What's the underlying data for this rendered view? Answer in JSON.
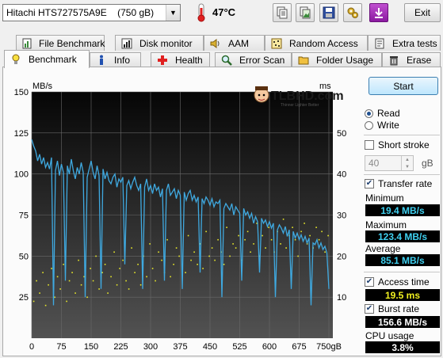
{
  "drive": {
    "name": "Hitachi HTS727575A9E",
    "size": "(750 gB)"
  },
  "temperature": "47°C",
  "exit_label": "Exit",
  "toolbar_icons": [
    "copy-text-icon",
    "copy-image-icon",
    "save-icon",
    "options-icon",
    "download-icon"
  ],
  "tabs_top": [
    {
      "label": "File Benchmark",
      "icon": "file-benchmark-icon"
    },
    {
      "label": "Disk monitor",
      "icon": "disk-monitor-icon"
    },
    {
      "label": "AAM",
      "icon": "speaker-icon"
    },
    {
      "label": "Random Access",
      "icon": "random-access-icon"
    },
    {
      "label": "Extra tests",
      "icon": "extra-tests-icon"
    }
  ],
  "tabs_bottom": [
    {
      "label": "Benchmark",
      "icon": "lightbulb-icon"
    },
    {
      "label": "Info",
      "icon": "info-icon"
    },
    {
      "label": "Health",
      "icon": "health-cross-icon"
    },
    {
      "label": "Error Scan",
      "icon": "magnifier-icon"
    },
    {
      "label": "Folder Usage",
      "icon": "folder-icon"
    },
    {
      "label": "Erase",
      "icon": "trash-icon"
    }
  ],
  "watermark": "TLBHD.com",
  "watermark_tagline": "Thinner Lighter Better",
  "controls": {
    "start_label": "Start",
    "read_label": "Read",
    "write_label": "Write",
    "read_selected": true,
    "short_stroke_label": "Short stroke",
    "short_stroke_checked": false,
    "short_stroke_value": "40",
    "short_stroke_unit": "gB",
    "transfer_rate_label": "Transfer rate",
    "transfer_rate_checked": true,
    "minimum_label": "Minimum",
    "minimum_value": "19.4 MB/s",
    "maximum_label": "Maximum",
    "maximum_value": "123.4 MB/s",
    "average_label": "Average",
    "average_value": "85.1 MB/s",
    "access_time_label": "Access time",
    "access_time_checked": true,
    "access_time_value": "19.5 ms",
    "burst_rate_label": "Burst rate",
    "burst_rate_checked": true,
    "burst_rate_value": "156.6 MB/s",
    "cpu_usage_label": "CPU usage",
    "cpu_usage_value": "3.8%"
  },
  "colors": {
    "transfer": "#3fa9e0",
    "access": "#e8e82a",
    "value_cyan": "#3fd0f0",
    "value_yellow": "#f0f020",
    "value_white": "#ffffff"
  },
  "chart_data": {
    "type": "line",
    "y_label": "MB/s",
    "y2_label": "ms",
    "x_unit": "gB",
    "x_ticks": [
      0,
      75,
      150,
      225,
      300,
      375,
      450,
      525,
      600,
      675,
      750
    ],
    "x_range": [
      0,
      760
    ],
    "y_ticks": [
      25,
      50,
      75,
      100,
      125,
      150
    ],
    "y_range": [
      0,
      150
    ],
    "y2_ticks": [
      10,
      20,
      30,
      40,
      50
    ],
    "y2_range": [
      0,
      60
    ],
    "grid": true,
    "series": [
      {
        "name": "Transfer rate",
        "unit": "MB/s",
        "x": [
          0,
          5,
          10,
          15,
          20,
          25,
          30,
          35,
          40,
          45,
          50,
          55,
          60,
          65,
          70,
          75,
          80,
          85,
          90,
          95,
          100,
          105,
          110,
          115,
          120,
          125,
          130,
          135,
          140,
          145,
          150,
          155,
          160,
          165,
          170,
          175,
          180,
          185,
          190,
          195,
          200,
          205,
          210,
          215,
          220,
          225,
          230,
          235,
          240,
          245,
          250,
          255,
          260,
          265,
          270,
          275,
          280,
          285,
          290,
          295,
          300,
          305,
          310,
          315,
          320,
          325,
          330,
          335,
          340,
          345,
          350,
          355,
          360,
          365,
          370,
          375,
          380,
          385,
          390,
          395,
          400,
          405,
          410,
          415,
          420,
          425,
          430,
          435,
          440,
          445,
          450,
          455,
          460,
          465,
          470,
          475,
          480,
          485,
          490,
          495,
          500,
          505,
          510,
          515,
          520,
          525,
          530,
          535,
          540,
          545,
          550,
          555,
          560,
          565,
          570,
          575,
          580,
          585,
          590,
          595,
          600,
          605,
          610,
          615,
          620,
          625,
          630,
          635,
          640,
          645,
          650,
          655,
          660,
          665,
          670,
          675,
          680,
          685,
          690,
          695,
          700,
          705,
          710,
          715,
          720,
          725,
          730,
          735,
          740,
          745,
          750
        ],
        "y": [
          121,
          117,
          114,
          108,
          112,
          106,
          110,
          104,
          107,
          103,
          110,
          20,
          102,
          108,
          99,
          106,
          101,
          35,
          105,
          100,
          109,
          102,
          97,
          104,
          100,
          107,
          101,
          25,
          98,
          103,
          108,
          101,
          97,
          105,
          99,
          30,
          103,
          97,
          101,
          96,
          94,
          98,
          100,
          92,
          97,
          95,
          98,
          45,
          93,
          96,
          91,
          95,
          98,
          93,
          90,
          94,
          30,
          92,
          97,
          90,
          93,
          88,
          94,
          90,
          92,
          86,
          91,
          35,
          90,
          94,
          87,
          89,
          91,
          85,
          90,
          87,
          30,
          89,
          84,
          88,
          90,
          84,
          87,
          83,
          86,
          40,
          85,
          82,
          86,
          84,
          81,
          85,
          80,
          83,
          82,
          84,
          25,
          79,
          82,
          80,
          78,
          82,
          75,
          80,
          78,
          76,
          35,
          79,
          75,
          77,
          73,
          76,
          70,
          74,
          71,
          40,
          73,
          70,
          72,
          68,
          71,
          67,
          70,
          25,
          66,
          69,
          67,
          64,
          68,
          62,
          66,
          30,
          65,
          61,
          64,
          60,
          63,
          59,
          62,
          58,
          61,
          20,
          58,
          57,
          60,
          55,
          58,
          54,
          56,
          52,
          30
        ]
      },
      {
        "name": "Access time",
        "unit": "ms",
        "type": "scatter",
        "x": [
          5,
          12,
          20,
          28,
          35,
          42,
          50,
          58,
          65,
          72,
          80,
          88,
          95,
          102,
          110,
          118,
          125,
          132,
          140,
          148,
          155,
          162,
          170,
          178,
          185,
          192,
          200,
          208,
          215,
          222,
          230,
          238,
          245,
          252,
          260,
          268,
          275,
          282,
          290,
          298,
          305,
          312,
          320,
          328,
          335,
          342,
          350,
          358,
          365,
          372,
          380,
          388,
          395,
          402,
          410,
          418,
          425,
          432,
          440,
          448,
          455,
          462,
          470,
          478,
          485,
          492,
          500,
          508,
          515,
          522,
          530,
          538,
          545,
          552,
          560,
          568,
          575,
          582,
          590,
          598,
          605,
          612,
          620,
          628,
          635,
          642,
          650,
          658,
          665,
          672,
          680,
          688,
          695,
          702,
          710,
          718,
          725,
          732,
          740,
          748
        ],
        "y": [
          9,
          14,
          11,
          16,
          8,
          13,
          17,
          10,
          15,
          12,
          18,
          9,
          14,
          16,
          11,
          19,
          13,
          15,
          10,
          17,
          14,
          20,
          12,
          16,
          18,
          11,
          15,
          21,
          13,
          17,
          19,
          14,
          12,
          22,
          16,
          18,
          13,
          20,
          15,
          23,
          17,
          14,
          21,
          19,
          16,
          24,
          15,
          18,
          22,
          20,
          17,
          16,
          25,
          19,
          21,
          18,
          23,
          17,
          26,
          20,
          22,
          19,
          24,
          21,
          18,
          27,
          20,
          23,
          22,
          25,
          19,
          24,
          26,
          21,
          23,
          28,
          20,
          25,
          22,
          27,
          24,
          21,
          26,
          23,
          29,
          22,
          25,
          27,
          24,
          20,
          26,
          28,
          23,
          25,
          22,
          27,
          24,
          26,
          21,
          25
        ]
      }
    ]
  }
}
